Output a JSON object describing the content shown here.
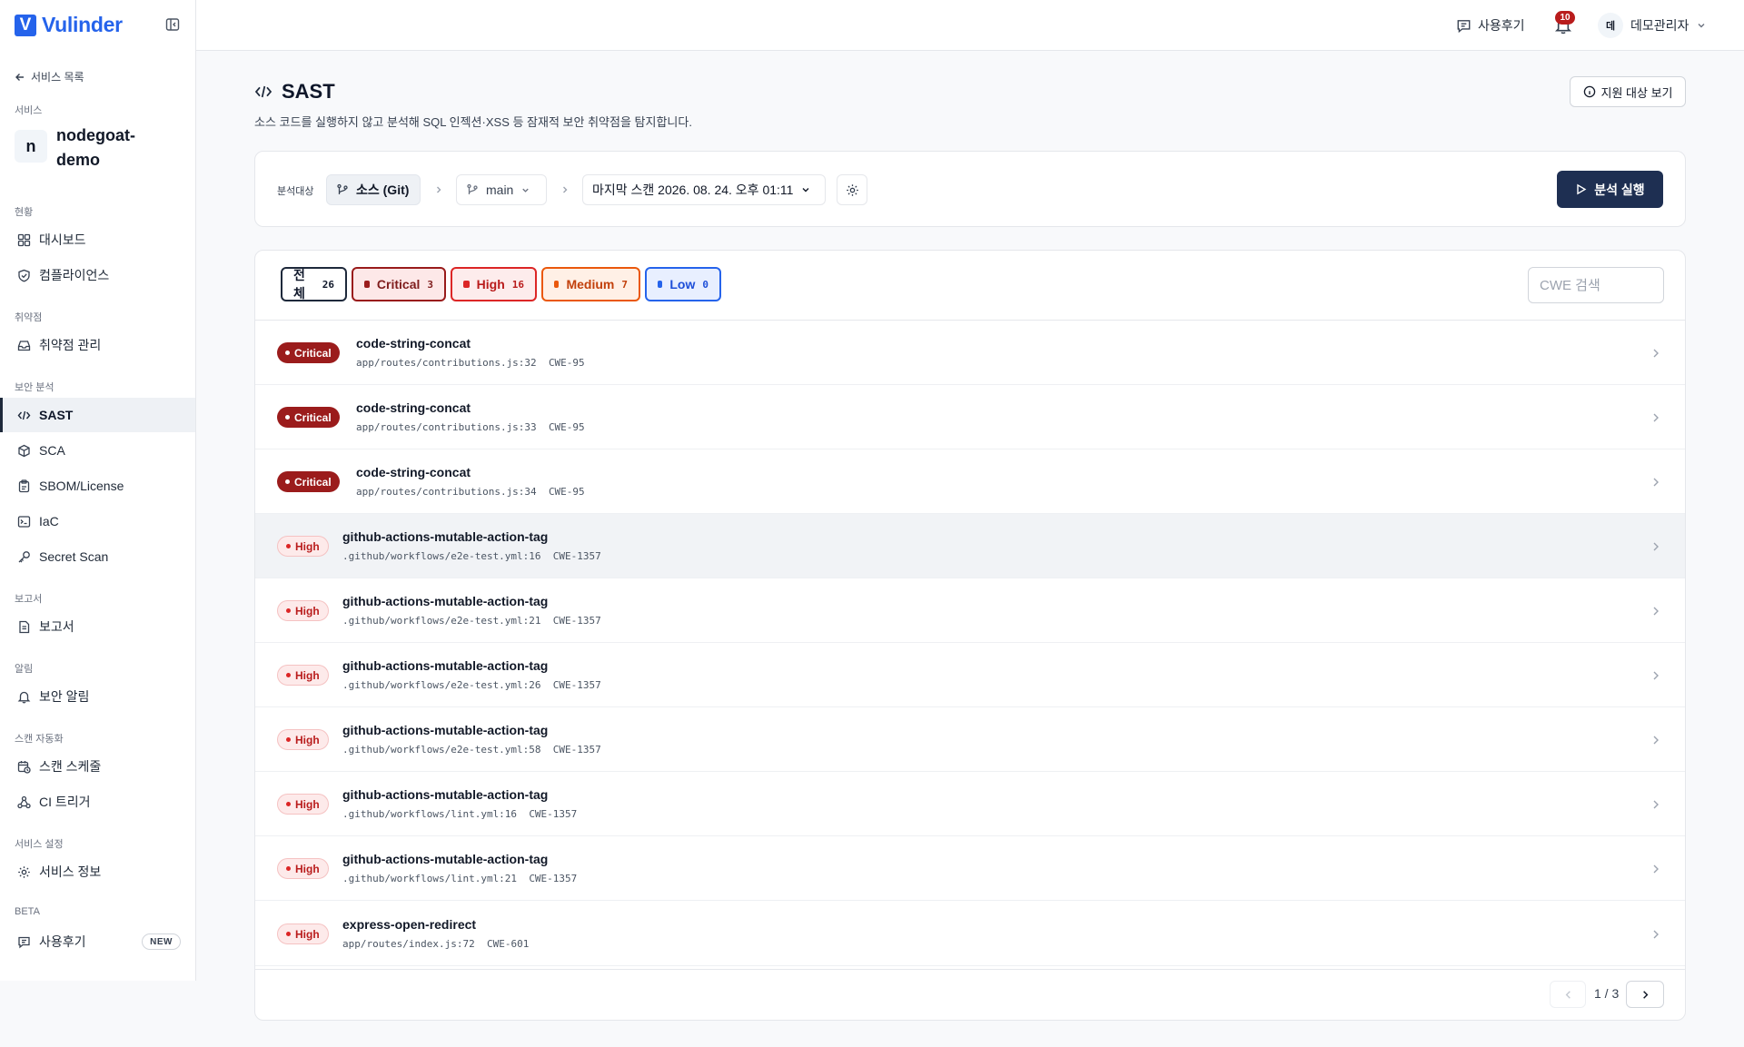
{
  "brand": {
    "logo_letter": "V",
    "name": "Vulinder"
  },
  "sidebar": {
    "back_label": "서비스 목록",
    "service_section_label": "서비스",
    "service_avatar": "n",
    "service_name": "nodegoat-demo",
    "sections": [
      {
        "label": "현황",
        "items": [
          {
            "label": "대시보드",
            "icon": "dashboard-icon"
          },
          {
            "label": "컴플라이언스",
            "icon": "shield-icon"
          }
        ]
      },
      {
        "label": "취약점",
        "items": [
          {
            "label": "취약점 관리",
            "icon": "inbox-icon"
          }
        ]
      },
      {
        "label": "보안 분석",
        "items": [
          {
            "label": "SAST",
            "icon": "code-icon",
            "active": true
          },
          {
            "label": "SCA",
            "icon": "package-icon"
          },
          {
            "label": "SBOM/License",
            "icon": "clipboard-icon"
          },
          {
            "label": "IaC",
            "icon": "terminal-icon"
          },
          {
            "label": "Secret Scan",
            "icon": "key-icon"
          }
        ]
      },
      {
        "label": "보고서",
        "items": [
          {
            "label": "보고서",
            "icon": "document-icon"
          }
        ]
      },
      {
        "label": "알림",
        "items": [
          {
            "label": "보안 알림",
            "icon": "bell-icon"
          }
        ]
      },
      {
        "label": "스캔 자동화",
        "items": [
          {
            "label": "스캔 스케줄",
            "icon": "calendar-clock-icon"
          },
          {
            "label": "CI 트리거",
            "icon": "webhook-icon"
          }
        ]
      },
      {
        "label": "서비스 설정",
        "items": [
          {
            "label": "서비스 정보",
            "icon": "gear-icon"
          }
        ]
      },
      {
        "label": "BETA",
        "items": [
          {
            "label": "사용후기",
            "icon": "message-icon",
            "badge": "NEW"
          }
        ]
      }
    ]
  },
  "topbar": {
    "review_label": "사용후기",
    "notification_count": "10",
    "user_initial": "데",
    "user_name": "데모관리자"
  },
  "page": {
    "title": "SAST",
    "description": "소스 코드를 실행하지 않고 분석해 SQL 인젝션·XSS 등 잠재적 보안 취약점을 탐지합니다.",
    "support_button": "지원 대상 보기"
  },
  "scan": {
    "target_label": "분석대상",
    "source": "소스 (Git)",
    "branch": "main",
    "last_scan": "마지막 스캔 2026. 08. 24. 오후 01:11",
    "run_button": "분석 실행"
  },
  "filters": {
    "all": {
      "label": "전체",
      "count": "26"
    },
    "critical": {
      "label": "Critical",
      "count": "3"
    },
    "high": {
      "label": "High",
      "count": "16"
    },
    "medium": {
      "label": "Medium",
      "count": "7"
    },
    "low": {
      "label": "Low",
      "count": "0"
    },
    "cwe_placeholder": "CWE 검색"
  },
  "findings": [
    {
      "severity": "Critical",
      "rule": "code-string-concat",
      "location": "app/routes/contributions.js:32",
      "cwe": "CWE-95"
    },
    {
      "severity": "Critical",
      "rule": "code-string-concat",
      "location": "app/routes/contributions.js:33",
      "cwe": "CWE-95"
    },
    {
      "severity": "Critical",
      "rule": "code-string-concat",
      "location": "app/routes/contributions.js:34",
      "cwe": "CWE-95"
    },
    {
      "severity": "High",
      "rule": "github-actions-mutable-action-tag",
      "location": ".github/workflows/e2e-test.yml:16",
      "cwe": "CWE-1357",
      "highlighted": true
    },
    {
      "severity": "High",
      "rule": "github-actions-mutable-action-tag",
      "location": ".github/workflows/e2e-test.yml:21",
      "cwe": "CWE-1357"
    },
    {
      "severity": "High",
      "rule": "github-actions-mutable-action-tag",
      "location": ".github/workflows/e2e-test.yml:26",
      "cwe": "CWE-1357"
    },
    {
      "severity": "High",
      "rule": "github-actions-mutable-action-tag",
      "location": ".github/workflows/e2e-test.yml:58",
      "cwe": "CWE-1357"
    },
    {
      "severity": "High",
      "rule": "github-actions-mutable-action-tag",
      "location": ".github/workflows/lint.yml:16",
      "cwe": "CWE-1357"
    },
    {
      "severity": "High",
      "rule": "github-actions-mutable-action-tag",
      "location": ".github/workflows/lint.yml:21",
      "cwe": "CWE-1357"
    },
    {
      "severity": "High",
      "rule": "express-open-redirect",
      "location": "app/routes/index.js:72",
      "cwe": "CWE-601"
    }
  ],
  "pagination": {
    "current": "1",
    "total": "3",
    "label": "1 / 3"
  },
  "colors": {
    "brand": "#2563eb",
    "primary_button": "#1e2f52",
    "critical": "#9b1c1c",
    "high": "#dc2626",
    "medium": "#ea580c",
    "low": "#2563eb"
  }
}
